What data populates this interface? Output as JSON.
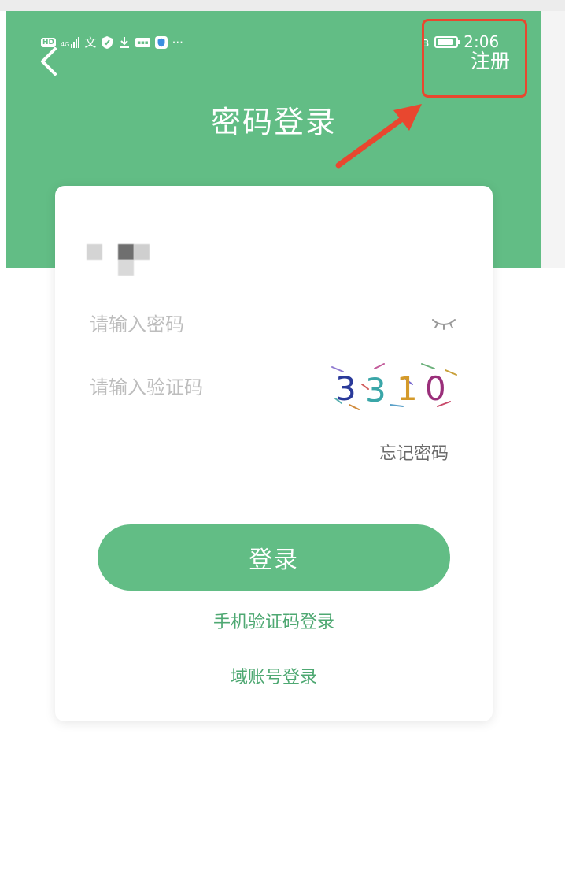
{
  "status_bar": {
    "hd_badge": "HD",
    "network": "4G",
    "time": "2:06",
    "icons": [
      "signal-icon",
      "translate-icon",
      "shield-icon",
      "download-icon",
      "app-chip-icon",
      "security-shield-icon",
      "more-dots-icon",
      "bluetooth-icon",
      "battery-icon"
    ],
    "battery_level": 0.9
  },
  "header": {
    "title": "密码登录",
    "register_label": "注册",
    "back_icon": "chevron-left-icon"
  },
  "form": {
    "password_placeholder": "请输入密码",
    "password_toggle_icon": "eye-closed-icon",
    "captcha_placeholder": "请输入验证码",
    "captcha_code": "3310",
    "forgot_password_label": "忘记密码",
    "login_button_label": "登录",
    "sms_login_label": "手机验证码登录",
    "domain_login_label": "域账号登录"
  },
  "colors": {
    "primary": "#62bd85",
    "link": "#4ea872",
    "annotation": "#e8472f",
    "captcha_digits": [
      "#2a3a9a",
      "#3aa6a8",
      "#d49a2a",
      "#9a2f7a"
    ]
  }
}
